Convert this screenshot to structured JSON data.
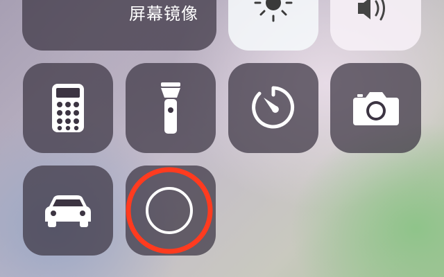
{
  "screen_mirroring": {
    "label": "屏幕镜像",
    "icon": "airplay-icon"
  },
  "brightness": {
    "icon": "sun-icon"
  },
  "volume": {
    "icon": "speaker-icon"
  },
  "row2": [
    {
      "name": "calculator",
      "icon": "calculator-icon"
    },
    {
      "name": "flashlight",
      "icon": "flashlight-icon"
    },
    {
      "name": "timer",
      "icon": "timer-icon"
    },
    {
      "name": "camera",
      "icon": "camera-icon"
    }
  ],
  "row3": [
    {
      "name": "do-not-disturb-while-driving",
      "icon": "car-icon"
    },
    {
      "name": "screen-recording",
      "icon": "record-icon",
      "highlight_color": "#ff3b1f"
    }
  ],
  "colors": {
    "tile_dark": "#3c3442",
    "icon": "#ffffff",
    "highlight": "#ff3b1f"
  }
}
